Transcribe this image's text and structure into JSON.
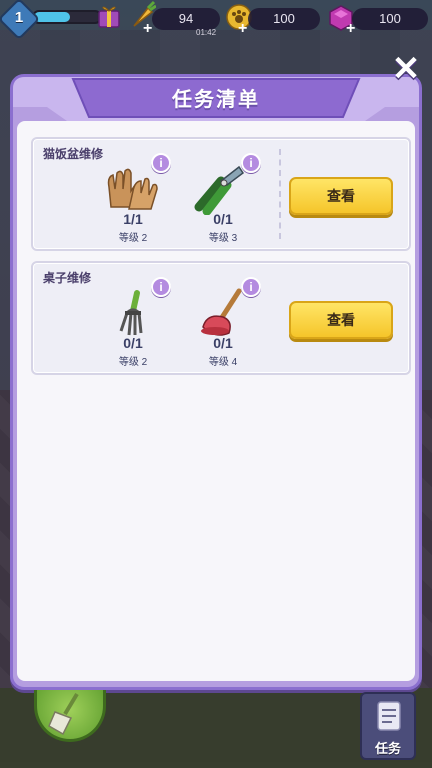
{
  "hud": {
    "player_level": "1",
    "energy": "94",
    "energy_timer": "01:42",
    "paw_coins": "100",
    "gems": "100",
    "plus": "+"
  },
  "panel": {
    "title": "任务清单",
    "close_label": "✕"
  },
  "tasks": [
    {
      "name": "猫饭盆维修",
      "button_label": "查看",
      "items": [
        {
          "icon": "gloves-icon",
          "count": "1/1",
          "level": "等级 2"
        },
        {
          "icon": "pruning-shears-icon",
          "count": "0/1",
          "level": "等级 3"
        }
      ]
    },
    {
      "name": "桌子维修",
      "button_label": "查看",
      "items": [
        {
          "icon": "garden-fork-icon",
          "count": "0/1",
          "level": "等级 2"
        },
        {
          "icon": "plunger-icon",
          "count": "0/1",
          "level": "等级 4"
        }
      ]
    }
  ],
  "info_label": "i",
  "bottom": {
    "tasks_label": "任务"
  },
  "colors": {
    "panel": "#b59ee0",
    "button": "#f5c52a",
    "info": "#b48be0"
  }
}
